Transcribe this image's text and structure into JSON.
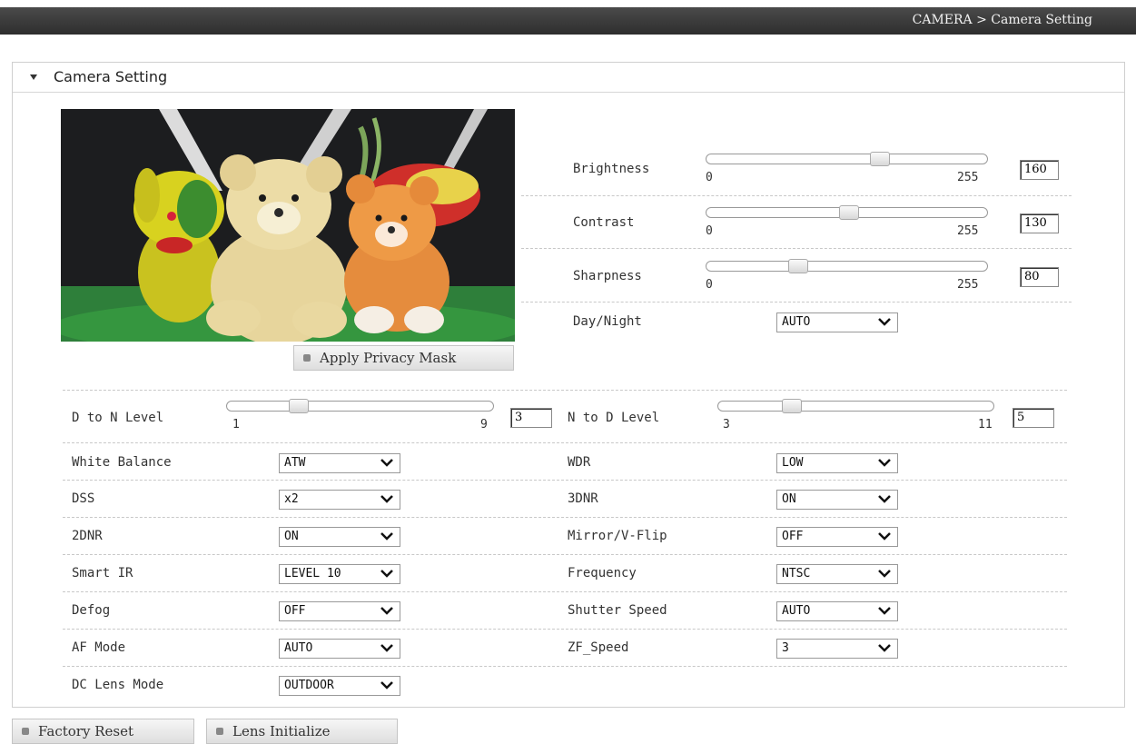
{
  "breadcrumb": "CAMERA > Camera Setting",
  "panel": {
    "title": "Camera Setting"
  },
  "buttons": {
    "privacy_mask": "Apply Privacy Mask",
    "factory_reset": "Factory Reset",
    "lens_initialize": "Lens Initialize"
  },
  "sliders": {
    "brightness": {
      "label": "Brightness",
      "min": "0",
      "max": "255",
      "value": "160"
    },
    "contrast": {
      "label": "Contrast",
      "min": "0",
      "max": "255",
      "value": "130"
    },
    "sharpness": {
      "label": "Sharpness",
      "min": "0",
      "max": "255",
      "value": "80"
    },
    "d_to_n": {
      "label": "D to N Level",
      "min": "1",
      "max": "9",
      "value": "3"
    },
    "n_to_d": {
      "label": "N to D Level",
      "min": "3",
      "max": "11",
      "value": "5"
    }
  },
  "selects": {
    "day_night": {
      "label": "Day/Night",
      "value": "AUTO"
    },
    "white_balance": {
      "label": "White Balance",
      "value": "ATW"
    },
    "wdr": {
      "label": "WDR",
      "value": "LOW"
    },
    "dss": {
      "label": "DSS",
      "value": "x2"
    },
    "dnr3": {
      "label": "3DNR",
      "value": "ON"
    },
    "dnr2": {
      "label": "2DNR",
      "value": "ON"
    },
    "mirror": {
      "label": "Mirror/V-Flip",
      "value": "OFF"
    },
    "smart_ir": {
      "label": "Smart IR",
      "value": "LEVEL 10"
    },
    "frequency": {
      "label": "Frequency",
      "value": "NTSC"
    },
    "defog": {
      "label": "Defog",
      "value": "OFF"
    },
    "shutter": {
      "label": "Shutter Speed",
      "value": "AUTO"
    },
    "af_mode": {
      "label": "AF Mode",
      "value": "AUTO"
    },
    "zf_speed": {
      "label": "ZF_Speed",
      "value": "3"
    },
    "dc_lens": {
      "label": "DC Lens Mode",
      "value": "OUTDOOR"
    }
  },
  "icons": {
    "collapse": "caret-down-icon",
    "button_bullet": "square-bullet-icon",
    "dropdown": "chevron-down-icon"
  }
}
